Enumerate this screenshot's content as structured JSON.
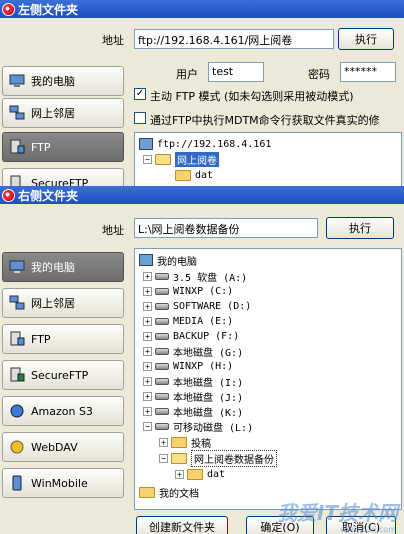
{
  "top": {
    "title": "左侧文件夹",
    "address_label": "地址",
    "address_value": "ftp://192.168.4.161/网上阅卷",
    "go_label": "执行",
    "user_label": "用户",
    "user_value": "test",
    "password_label": "密码",
    "password_value": "******",
    "passive_label": "主动 FTP 模式 (如未勾选则采用被动模式)",
    "mdtm_label": "通过FTP中执行MDTM命令行获取文件真实的修",
    "nav": [
      "我的电脑",
      "网上邻居",
      "FTP",
      "SecureFTP"
    ],
    "tree": [
      "ftp://192.168.4.161",
      "网上阅卷",
      "dat"
    ]
  },
  "bottom": {
    "title": "右侧文件夹",
    "address_label": "地址",
    "address_value": "L:\\网上阅卷数据备份",
    "go_label": "执行",
    "nav": [
      "我的电脑",
      "网上邻居",
      "FTP",
      "SecureFTP",
      "Amazon S3",
      "WebDAV",
      "WinMobile"
    ],
    "tree": [
      "我的电脑",
      "3.5 软盘 (A:)",
      "WINXP (C:)",
      "SOFTWARE (D:)",
      "MEDIA (E:)",
      "BACKUP (F:)",
      "本地磁盘 (G:)",
      "WINXP (H:)",
      "本地磁盘 (I:)",
      "本地磁盘 (J:)",
      "本地磁盘 (K:)",
      "可移动磁盘 (L:)",
      "投稿",
      "网上阅卷数据备份",
      "dat",
      "我的文档"
    ],
    "new_folder_label": "创建新文件夹",
    "ok_label": "确定(O)",
    "cancel_label": "取消(C)"
  },
  "watermark": {
    "text": "我爱IT技术网",
    "url": "www.52ij.com"
  }
}
